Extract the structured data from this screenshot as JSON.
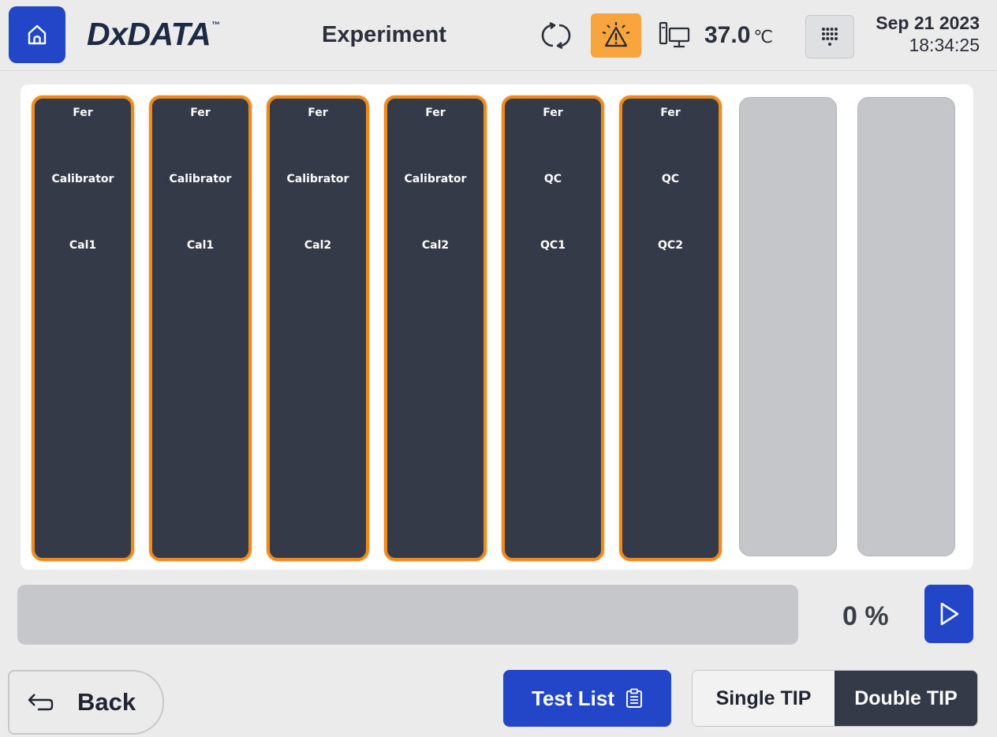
{
  "header": {
    "home_icon": "home-icon",
    "logo_text": "DxDATA",
    "logo_tm": "™",
    "screen_title": "Experiment",
    "sync_icon": "sync-icon",
    "alert_icon": "warning-icon",
    "alert_color": "#f7a53c",
    "pc_icon": "computer-icon",
    "temperature_value": "37.0",
    "temperature_unit": "℃",
    "keypad_icon": "keypad-icon",
    "date": "Sep 21 2023",
    "time": "18:34:25"
  },
  "rack": {
    "slots": [
      {
        "state": "filled",
        "test": "Fer",
        "type": "Calibrator",
        "level": "Cal1"
      },
      {
        "state": "filled",
        "test": "Fer",
        "type": "Calibrator",
        "level": "Cal1"
      },
      {
        "state": "filled",
        "test": "Fer",
        "type": "Calibrator",
        "level": "Cal2"
      },
      {
        "state": "filled",
        "test": "Fer",
        "type": "Calibrator",
        "level": "Cal2"
      },
      {
        "state": "filled",
        "test": "Fer",
        "type": "QC",
        "level": "QC1"
      },
      {
        "state": "filled",
        "test": "Fer",
        "type": "QC",
        "level": "QC2"
      },
      {
        "state": "empty"
      },
      {
        "state": "empty"
      }
    ],
    "filled_color": "#343a47",
    "border_color": "#ef8a1e",
    "empty_color": "#c5c6c9"
  },
  "progress": {
    "value": 0,
    "text": "0 %",
    "start_icon": "play-icon"
  },
  "footer": {
    "back_label": "Back",
    "back_icon": "back-arrow-icon",
    "test_list_label": "Test List",
    "test_list_icon": "clipboard-icon",
    "tip_single_label": "Single TIP",
    "tip_double_label": "Double TIP",
    "tip_selected": "Double TIP"
  },
  "colors": {
    "accent": "#2346c8",
    "background": "#ebebeb"
  }
}
